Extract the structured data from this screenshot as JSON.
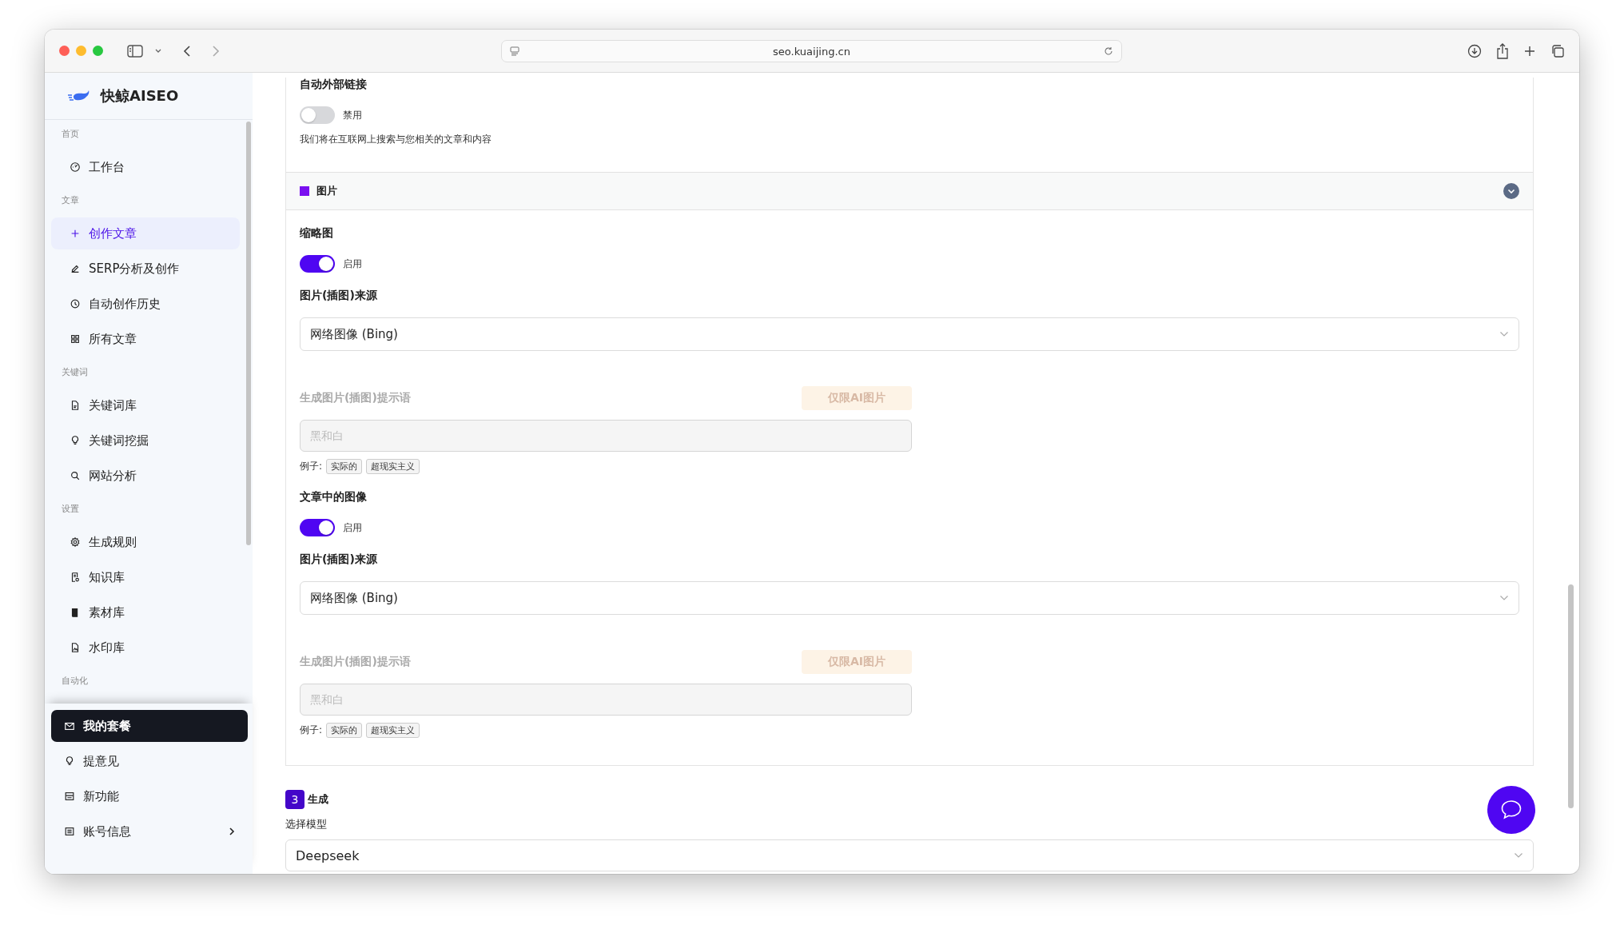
{
  "browser": {
    "url": "seo.kuaijing.cn"
  },
  "sidebar": {
    "brand": "快鲸AISEO",
    "groups": [
      {
        "title": "首页",
        "items": [
          {
            "label": "工作台",
            "selected": false
          }
        ]
      },
      {
        "title": "文章",
        "items": [
          {
            "label": "创作文章",
            "selected": true
          },
          {
            "label": "SERP分析及创作",
            "selected": false
          },
          {
            "label": "自动创作历史",
            "selected": false
          },
          {
            "label": "所有文章",
            "selected": false
          }
        ]
      },
      {
        "title": "关键词",
        "items": [
          {
            "label": "关键词库",
            "selected": false
          },
          {
            "label": "关键词挖掘",
            "selected": false
          },
          {
            "label": "网站分析",
            "selected": false
          }
        ]
      },
      {
        "title": "设置",
        "items": [
          {
            "label": "生成规则",
            "selected": false
          },
          {
            "label": "知识库",
            "selected": false
          },
          {
            "label": "素材库",
            "selected": false
          },
          {
            "label": "水印库",
            "selected": false
          }
        ]
      },
      {
        "title": "自动化"
      }
    ],
    "footer_items": [
      {
        "label": "我的套餐",
        "selected": true
      },
      {
        "label": "提意见",
        "selected": false
      },
      {
        "label": "新功能",
        "selected": false
      },
      {
        "label": "账号信息",
        "selected": false
      }
    ]
  },
  "external_links": {
    "title": "自动外部链接",
    "toggle": {
      "on": false,
      "label": "禁用"
    },
    "description": "我们将在互联网上搜索与您相关的文章和内容"
  },
  "images_section": {
    "title": "图片",
    "expanded": true,
    "fields": [
      {
        "kind": "toggle",
        "title": "缩略图",
        "on": true,
        "label": "启用"
      },
      {
        "kind": "select",
        "title": "图片(插图)来源",
        "value": "网络图像 (Bing)"
      },
      {
        "kind": "prompt",
        "title": "生成图片(插图)提示语",
        "badge": "仅限AI图片",
        "placeholder": "黑和白",
        "disabled": true,
        "examples_label": "例子:",
        "examples": [
          "实际的",
          "超现实主义"
        ]
      },
      {
        "kind": "toggle",
        "title": "文章中的图像",
        "on": true,
        "label": "启用"
      },
      {
        "kind": "select",
        "title": "图片(插图)来源",
        "value": "网络图像 (Bing)"
      },
      {
        "kind": "prompt",
        "title": "生成图片(插图)提示语",
        "badge": "仅限AI图片",
        "placeholder": "黑和白",
        "disabled": true,
        "examples_label": "例子:",
        "examples": [
          "实际的",
          "超现实主义"
        ]
      }
    ]
  },
  "generate": {
    "step": "3",
    "title": "生成",
    "model_label": "选择模型",
    "model_value": "Deepseek"
  }
}
